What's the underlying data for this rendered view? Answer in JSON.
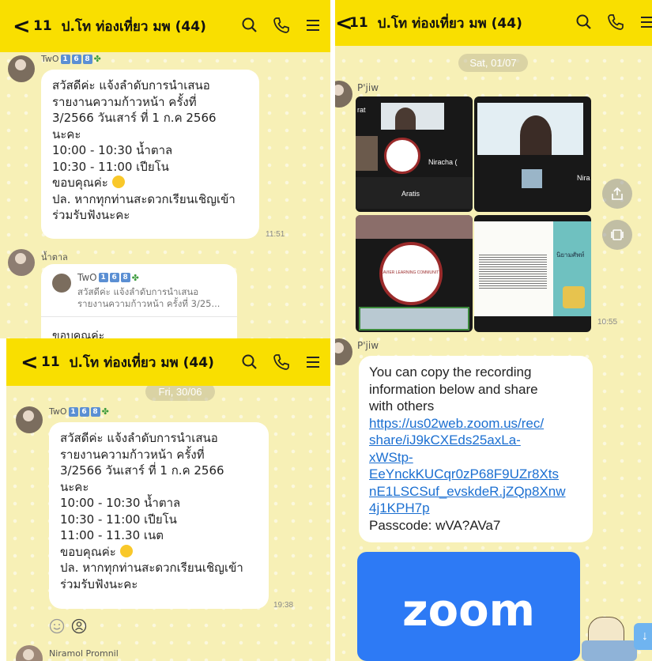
{
  "chat": {
    "back_count": "11",
    "title": "ป.โท ท่องเที่ยว มพ (44)"
  },
  "panel1": {
    "sender": "TwO",
    "badges": [
      "1",
      "6",
      "8"
    ],
    "message": [
      "สวัสดีค่ะ แจ้งลำดับการนำเสนอ",
      "รายงานความก้าวหน้า ครั้งที่",
      "3/2566 วันเสาร์ ที่ 1 ก.ค 2566",
      "นะคะ",
      "10:00 - 10:30 น้ำตาล",
      "10:30 - 11:00 เปียโน",
      "ขอบคุณค่ะ",
      "ปล. หากทุกท่านสะดวกเรียนเชิญเข้า",
      "ร่วมรับฟังนะคะ"
    ],
    "time": "11:51",
    "reply_sender": "น้ำตาล",
    "quoted_sender": "TwO",
    "quoted_line1": "สวัสดีค่ะ แจ้งลำดับการนำเสนอ",
    "quoted_line2": "รายงานความก้าวหน้า ครั้งที่ 3/25...",
    "reply_text": "ขอบคุณค่ะ"
  },
  "panel2": {
    "date": "Sat, 01/07",
    "sender1": "P'jiw",
    "tile_names": [
      "rat",
      "Niracha (",
      "Aratis",
      "Nira"
    ],
    "seal_text": "XAVIER LEARNING COMMUNITY",
    "slide_caption": "นิยามศัพท์",
    "time1": "10:55",
    "sender2": "P'jiw",
    "message": [
      "You can copy the recording",
      "information below and share",
      "with others"
    ],
    "link": [
      "https://us02web.zoom.us/rec/",
      "share/iJ9kCXEds25axLa-",
      "xWStp-",
      "EeYnckKUCqr0zP68F9UZr8Xts",
      "nE1LSCSuf_evskdeR.jZQp8Xnw",
      "4j1KPH7p"
    ],
    "passcode": "Passcode: wVA?AVa7",
    "zoom_logo": "zoom"
  },
  "panel3": {
    "date": "Fri, 30/06",
    "sender": "TwO",
    "message": [
      "สวัสดีค่ะ แจ้งลำดับการนำเสนอ",
      "รายงานความก้าวหน้า ครั้งที่",
      "3/2566 วันเสาร์ ที่ 1 ก.ค 2566",
      "นะคะ",
      "10:00 - 10:30 น้ำตาล",
      "10:30 - 11:00 เปียโน",
      "11:00 - 11.30 เนต",
      "ขอบคุณค่ะ",
      "ปล. หากทุกท่านสะดวกเรียนเชิญเข้า",
      "ร่วมรับฟังนะคะ"
    ],
    "time": "19:38",
    "next_sender": "Niramol Promnil"
  },
  "colors": {
    "header": "#f9df00",
    "background": "#f7f0b6",
    "link": "#1b6fd1",
    "zoom_blue": "#2d7af5"
  }
}
